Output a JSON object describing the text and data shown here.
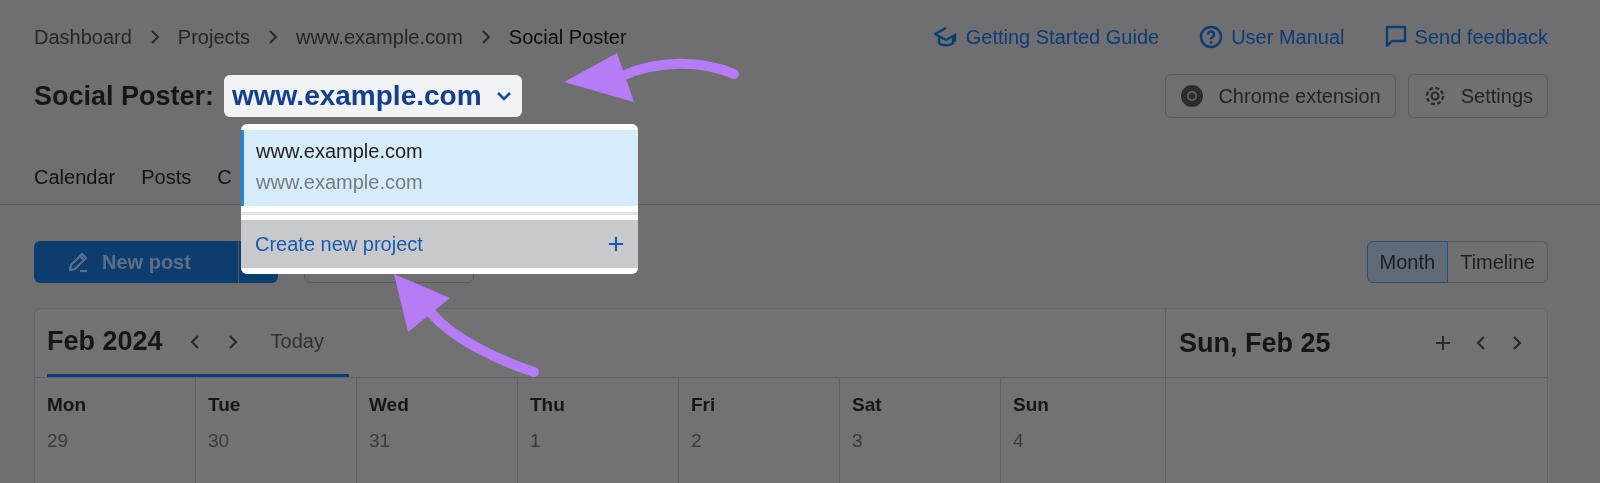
{
  "breadcrumbs": [
    {
      "label": "Dashboard"
    },
    {
      "label": "Projects"
    },
    {
      "label": "www.example.com"
    },
    {
      "label": "Social Poster"
    }
  ],
  "help_links": [
    {
      "label": "Getting Started Guide",
      "kind": "guide"
    },
    {
      "label": "User Manual",
      "kind": "manual"
    },
    {
      "label": "Send feedback",
      "kind": "feedback"
    }
  ],
  "header": {
    "title": "Social Poster:",
    "project_selector": {
      "value": "www.example.com",
      "expanded": true
    }
  },
  "header_buttons": [
    {
      "label": "Chrome extension",
      "kind": "chrome"
    },
    {
      "label": "Settings",
      "kind": "settings"
    }
  ],
  "tabs": [
    {
      "label": "Calendar"
    },
    {
      "label": "Posts"
    },
    {
      "label": "C"
    }
  ],
  "new_post_button": {
    "label": "New post"
  },
  "view_toggle": [
    {
      "label": "Month",
      "selected": true
    },
    {
      "label": "Timeline",
      "selected": false
    }
  ],
  "calendar": {
    "month": "Feb 2024",
    "today": "Today",
    "side_title": "Sun, Feb 25",
    "days": [
      {
        "name": "Mon",
        "date": "29"
      },
      {
        "name": "Tue",
        "date": "30"
      },
      {
        "name": "Wed",
        "date": "31"
      },
      {
        "name": "Thu",
        "date": "1"
      },
      {
        "name": "Fri",
        "date": "2"
      },
      {
        "name": "Sat",
        "date": "3"
      },
      {
        "name": "Sun",
        "date": "4"
      }
    ]
  },
  "dropdown": {
    "projects": [
      {
        "name": "www.example.com",
        "domain": "www.example.com",
        "selected": true
      }
    ],
    "create_label": "Create new project"
  }
}
